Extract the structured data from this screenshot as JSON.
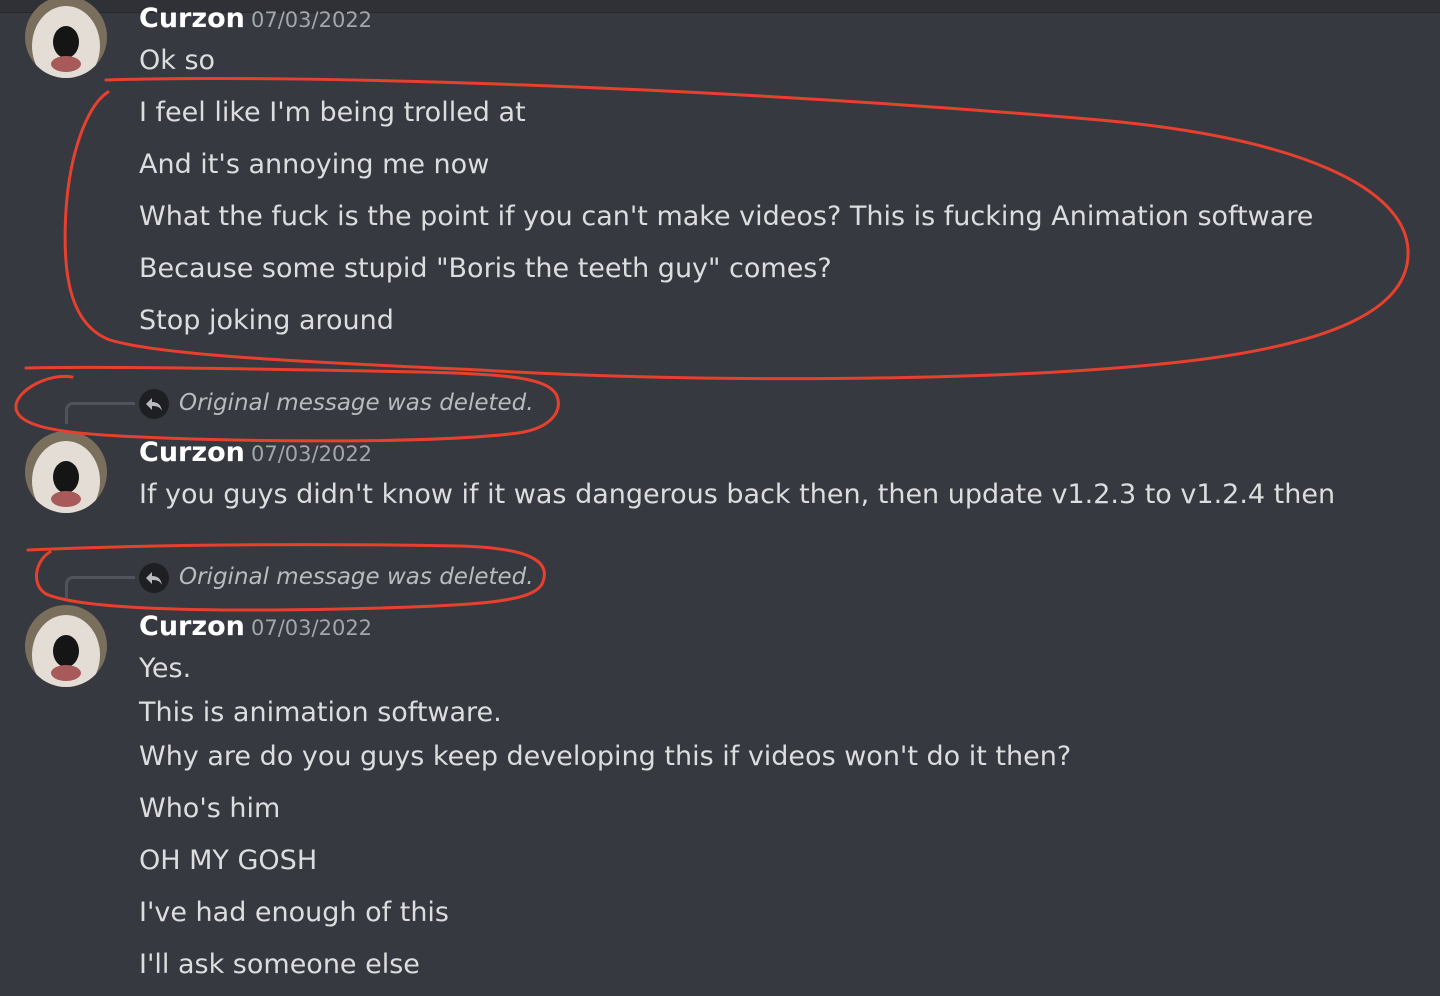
{
  "colors": {
    "background": "#36393f",
    "username": "#ffffff",
    "message": "#dcddde",
    "timestamp": "#a3a6aa",
    "annotation": "#e8402e"
  },
  "messages": [
    {
      "author": "Curzon",
      "timestamp": "07/03/2022",
      "lines": [
        "Ok so",
        "I feel like I'm being trolled at",
        "And it's annoying me now",
        "What the fuck is the point if you can't make videos? This is fucking Animation software",
        "Because some stupid \"Boris the teeth guy\" comes?",
        "Stop joking around"
      ]
    },
    {
      "reply": {
        "icon": "reply-arrow-icon",
        "text": "Original message was deleted."
      },
      "author": "Curzon",
      "timestamp": "07/03/2022",
      "lines": [
        "If you guys didn't know if it was dangerous back then, then update v1.2.3 to v1.2.4 then"
      ]
    },
    {
      "reply": {
        "icon": "reply-arrow-icon",
        "text": "Original message was deleted."
      },
      "author": "Curzon",
      "timestamp": "07/03/2022",
      "lines": [
        "Yes.",
        "This is animation software.",
        "Why are do you guys keep developing this if videos won't do it then?",
        "Who's him",
        "OH MY GOSH",
        "I've had enough of this",
        "I'll ask someone else"
      ]
    }
  ]
}
